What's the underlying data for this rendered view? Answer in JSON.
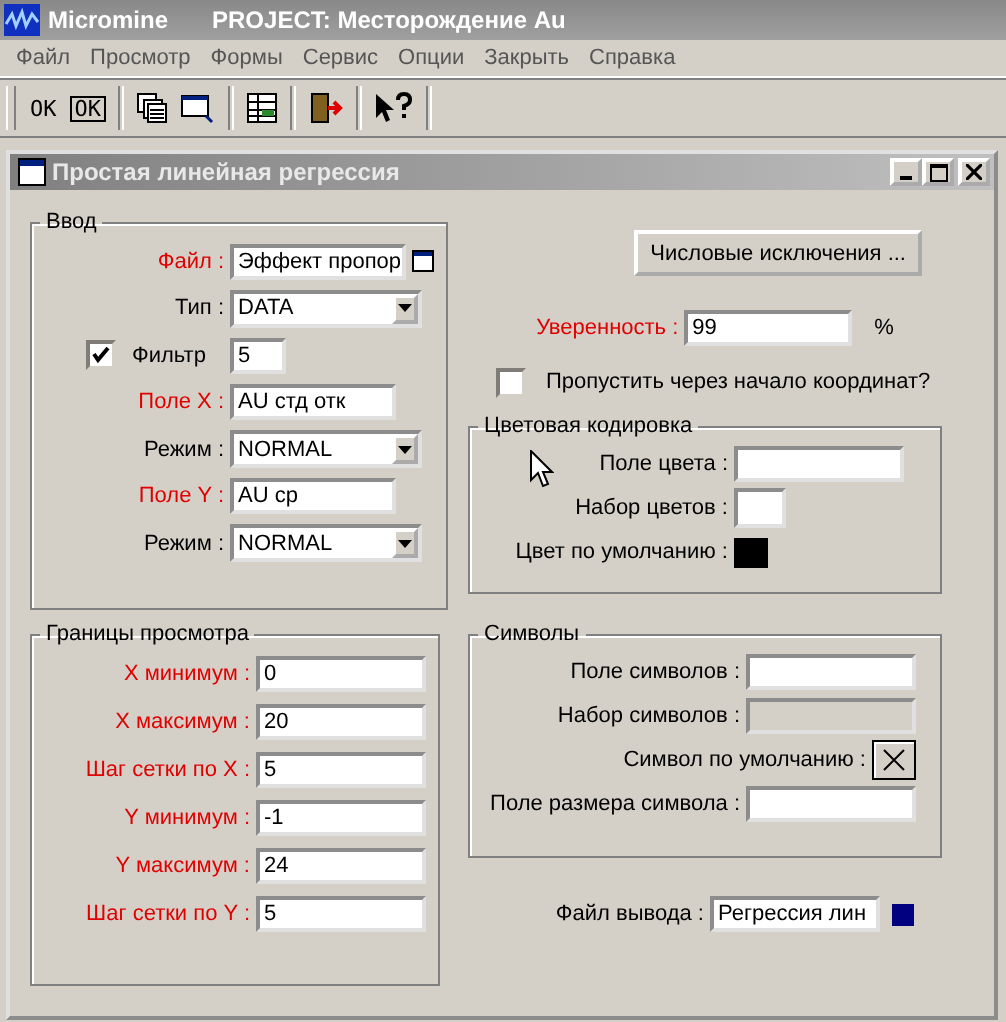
{
  "app": {
    "name": "Micromine",
    "project": "PROJECT: Месторождение Au"
  },
  "menu": [
    "Файл",
    "Просмотр",
    "Формы",
    "Сервис",
    "Опции",
    "Закрыть",
    "Справка"
  ],
  "toolbar": [
    {
      "kind": "plain",
      "label": "OK"
    },
    {
      "kind": "framed",
      "label": "OK"
    }
  ],
  "dialog": {
    "title": "Простая линейная регрессия"
  },
  "input_group": {
    "title": "Ввод",
    "rows": [
      {
        "kind": "file",
        "label": "Файл :",
        "required": true,
        "value": "Эффект пропор"
      },
      {
        "kind": "select",
        "label": "Тип :",
        "required": false,
        "value": "DATA"
      },
      {
        "kind": "check",
        "label": "Фильтр",
        "checked": true,
        "value": "5"
      },
      {
        "kind": "field",
        "label": "Поле X :",
        "required": true,
        "value": "AU стд отк"
      },
      {
        "kind": "select",
        "label": "Режим :",
        "required": false,
        "value": "NORMAL"
      },
      {
        "kind": "field",
        "label": "Поле Y :",
        "required": true,
        "value": "AU ср"
      },
      {
        "kind": "select",
        "label": "Режим :",
        "required": false,
        "value": "NORMAL"
      }
    ]
  },
  "bounds_group": {
    "title": "Границы просмотра",
    "rows": [
      {
        "label": "X минимум :",
        "required": true,
        "value": "0"
      },
      {
        "label": "X максимум :",
        "required": true,
        "value": "20"
      },
      {
        "label": "Шаг сетки по X :",
        "required": true,
        "value": "5"
      },
      {
        "label": "Y минимум :",
        "required": true,
        "value": "-1"
      },
      {
        "label": "Y максимум :",
        "required": true,
        "value": "24"
      },
      {
        "label": "Шаг сетки по Y :",
        "required": true,
        "value": "5"
      }
    ]
  },
  "exclusions_button": "Числовые исключения ...",
  "confidence": {
    "label": "Уверенность :",
    "required": true,
    "value": "99",
    "unit": "%"
  },
  "through_origin": {
    "label": "Пропустить через начало координат?",
    "checked": false
  },
  "color_group": {
    "title": "Цветовая кодировка",
    "rows": [
      {
        "kind": "field",
        "label": "Поле цвета :",
        "disabled": false
      },
      {
        "kind": "small",
        "label": "Набор цветов :",
        "disabled": false
      },
      {
        "kind": "color",
        "label": "Цвет по умолчанию :",
        "color": "#000000"
      }
    ]
  },
  "symbol_group": {
    "title": "Символы",
    "rows": [
      {
        "kind": "field",
        "label": "Поле символов :",
        "disabled": false
      },
      {
        "kind": "field",
        "label": "Набор символов :",
        "disabled": true
      },
      {
        "kind": "symbol",
        "label": "Символ по умолчанию :"
      },
      {
        "kind": "field",
        "label": "Поле размера символа :",
        "disabled": false
      }
    ]
  },
  "output": {
    "label": "Файл вывода :",
    "value": "Регрессия лин"
  }
}
